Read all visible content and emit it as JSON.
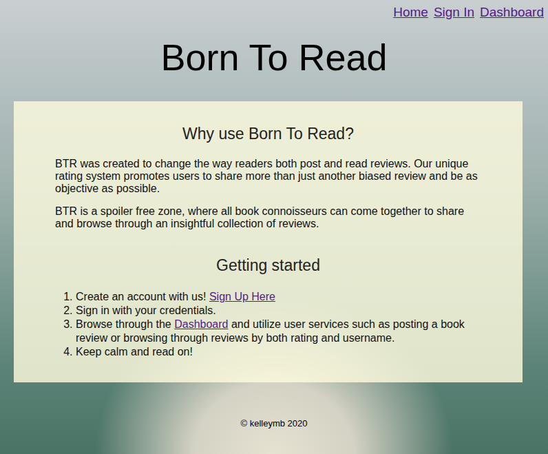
{
  "nav": [
    {
      "label": "Home"
    },
    {
      "label": "Sign In"
    },
    {
      "label": "Dashboard"
    }
  ],
  "title": "Born To Read",
  "about": {
    "heading": "Why use Born To Read?",
    "paragraphs": [
      "BTR was created to change the way readers both post and read reviews. Our unique rating system promotes users to share more than just another biased review and be as objective as possible.",
      "BTR is a spoiler free zone, where all book connoisseurs can come together to share and browse through an insightful collection of reviews."
    ]
  },
  "getting_started": {
    "heading": "Getting started",
    "steps": [
      [
        {
          "kind": "text",
          "text": "Create an account with us!"
        },
        {
          "kind": "link",
          "text": "Sign Up Here"
        }
      ],
      [
        {
          "kind": "text",
          "text": "Sign in with your credentials."
        }
      ],
      [
        {
          "kind": "text",
          "text": "Browse through the"
        },
        {
          "kind": "link",
          "text": "Dashboard"
        },
        {
          "kind": "text",
          "text": "and utilize user services such as posting a book review or browsing through reviews by both rating and username."
        }
      ],
      [
        {
          "kind": "text",
          "text": "Keep calm and read on!"
        }
      ]
    ]
  },
  "footer": "© kelleymb 2020"
}
